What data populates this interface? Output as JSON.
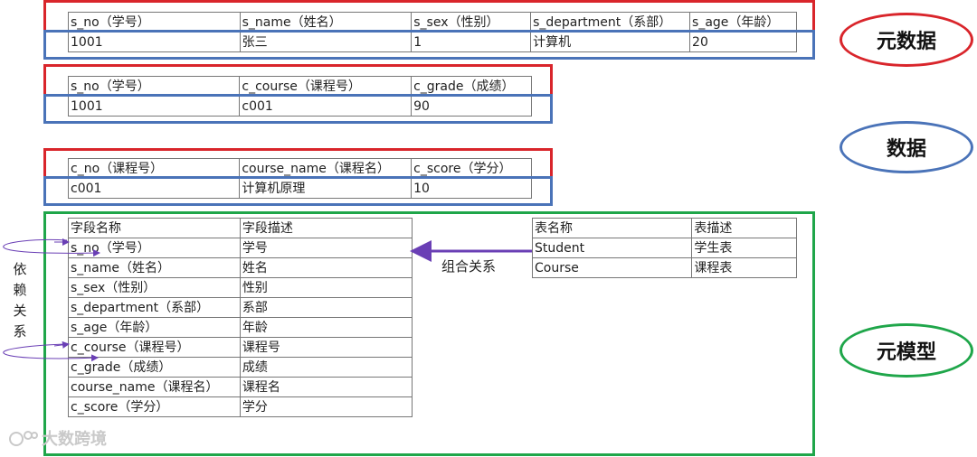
{
  "table_student": {
    "header": [
      "s_no（学号）",
      "s_name（姓名）",
      "s_sex（性别）",
      "s_department（系部）",
      "s_age（年龄）"
    ],
    "row": [
      "1001",
      "张三",
      "1",
      "计算机",
      "20"
    ]
  },
  "table_sc": {
    "header": [
      "s_no（学号）",
      "c_course（课程号）",
      "c_grade（成绩）"
    ],
    "row": [
      "1001",
      "c001",
      "90"
    ]
  },
  "table_course": {
    "header": [
      "c_no（课程号）",
      "course_name（课程名）",
      "c_score（学分）"
    ],
    "row": [
      "c001",
      "计算机原理",
      "10"
    ]
  },
  "field_table": {
    "header": [
      "字段名称",
      "字段描述"
    ],
    "rows": [
      [
        "s_no（学号）",
        "学号"
      ],
      [
        "s_name（姓名）",
        "姓名"
      ],
      [
        "s_sex（性别）",
        "性别"
      ],
      [
        "s_department（系部）",
        "系部"
      ],
      [
        "s_age（年龄）",
        "年龄"
      ],
      [
        "c_course（课程号）",
        "课程号"
      ],
      [
        "c_grade（成绩）",
        "成绩"
      ],
      [
        "course_name（课程名）",
        "课程名"
      ],
      [
        "c_score（学分）",
        "学分"
      ]
    ]
  },
  "table_table": {
    "header": [
      "表名称",
      "表描述"
    ],
    "rows": [
      [
        "Student",
        "学生表"
      ],
      [
        "Course",
        "课程表"
      ]
    ]
  },
  "labels": {
    "metadata": "元数据",
    "data": "数据",
    "metamodel": "元模型",
    "composition": "组合关系",
    "dependency": [
      "依",
      "赖",
      "关",
      "系"
    ],
    "watermark": "大数跨境"
  },
  "colors": {
    "red": "#d9252b",
    "blue": "#4a73b8",
    "green": "#1fa64a",
    "purple": "#6a3fb5"
  }
}
